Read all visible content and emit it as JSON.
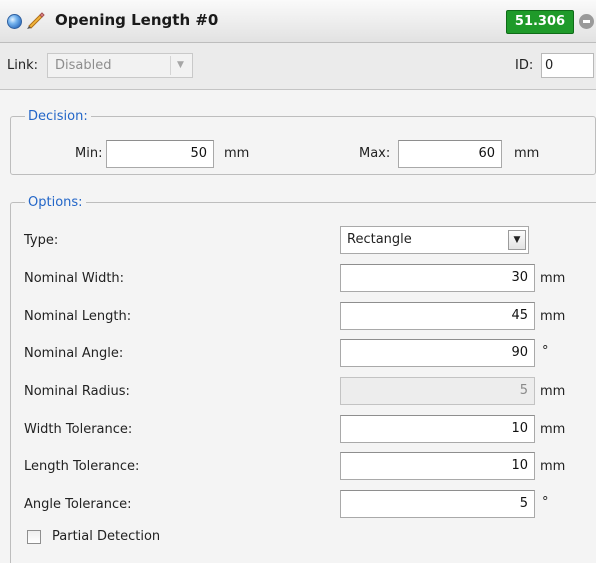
{
  "titlebar": {
    "title": "Opening Length #0",
    "value": "51.306"
  },
  "linkbar": {
    "link_label": "Link:",
    "link_value": "Disabled",
    "id_label": "ID:",
    "id_value": "0"
  },
  "decision": {
    "legend": "Decision:",
    "min_label": "Min:",
    "min_value": "50",
    "min_unit": "mm",
    "max_label": "Max:",
    "max_value": "60",
    "max_unit": "mm"
  },
  "options": {
    "legend": "Options:",
    "type_label": "Type:",
    "type_value": "Rectangle",
    "rows": [
      {
        "label": "Nominal Width:",
        "value": "30",
        "unit": "mm"
      },
      {
        "label": "Nominal Length:",
        "value": "45",
        "unit": "mm"
      },
      {
        "label": "Nominal Angle:",
        "value": "90",
        "unit": "°"
      },
      {
        "label": "Nominal Radius:",
        "value": "5",
        "unit": "mm",
        "disabled": true
      },
      {
        "label": "Width Tolerance:",
        "value": "10",
        "unit": "mm"
      },
      {
        "label": "Length Tolerance:",
        "value": "10",
        "unit": "mm"
      },
      {
        "label": "Angle Tolerance:",
        "value": "5",
        "unit": "°"
      }
    ],
    "partial_detection_label": "Partial Detection",
    "partial_detection_checked": false
  },
  "colors": {
    "legend_blue": "#2366c8",
    "badge_green": "#1f9a2a"
  }
}
